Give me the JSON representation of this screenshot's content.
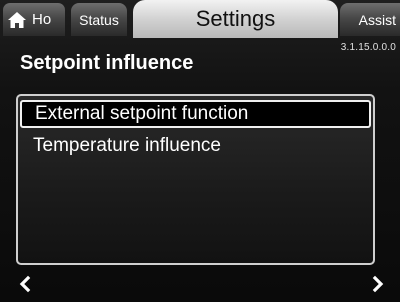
{
  "tabs": {
    "home_label": "Ho",
    "status_label": "Status",
    "settings_label": "Settings",
    "assist_label": "Assist"
  },
  "version": "3.1.15.0.0.0",
  "page_title": "Setpoint influence",
  "menu": {
    "items": [
      {
        "label": "External setpoint function",
        "selected": true
      },
      {
        "label": "Temperature influence",
        "selected": false
      }
    ]
  },
  "nav": {
    "prev_icon": "chevron-left-icon",
    "next_icon": "chevron-right-icon"
  },
  "icons": {
    "home": "home-icon"
  },
  "colors": {
    "active_tab": "#cfcfcf",
    "inactive_tab": "#4a4a4a",
    "background": "#121212",
    "text": "#ffffff"
  }
}
